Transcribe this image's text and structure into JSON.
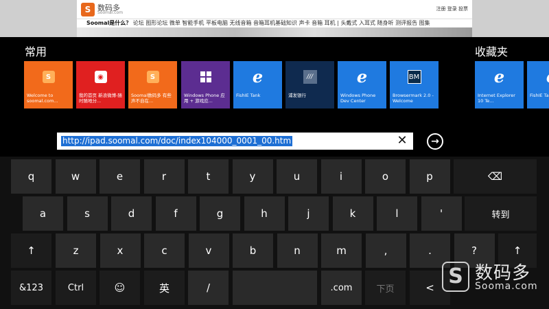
{
  "background_page": {
    "brand": "数码多",
    "brand_sub": "Soomal.com",
    "top_links": "注册 登录 投票",
    "nav_lead": "Soomal是什么？",
    "nav_items": "论坛 图形论坛 微单 智能手机 平板电脑 无线音箱 音箱耳机基础知识 声卡 音箱 耳机 | 头戴式 入耳式 随身听 测评报告 图集"
  },
  "sections": {
    "common": "常用",
    "favorites": "收藏夹"
  },
  "tiles": [
    {
      "label": "Welcome to soomal.com...",
      "icon": "S",
      "color": "#f26a1b"
    },
    {
      "label": "我的首页 新浪微博-随时随地分...",
      "icon": "weibo",
      "color": "#e02020"
    },
    {
      "label": "Soomal数码多 有些声不自在...",
      "icon": "S",
      "color": "#f26a1b"
    },
    {
      "label": "Windows Phone 应用 + 游戏应...",
      "icon": "windows",
      "color": "#5c2d91"
    },
    {
      "label": "FishIE Tank",
      "icon": "e",
      "color": "#1f7ae0"
    },
    {
      "label": "浦发银行",
      "icon": "bank",
      "color": "#0f2a4f"
    },
    {
      "label": "Windows Phone Dev Center",
      "icon": "e",
      "color": "#1f7ae0"
    },
    {
      "label": "Browsermark 2.0 - Welcome",
      "icon": "BM",
      "color": "#1f7ae0"
    },
    {
      "label": "Internet Explorer 10 Te...",
      "icon": "e",
      "color": "#1f7ae0"
    },
    {
      "label": "FishIE Tank",
      "icon": "e",
      "color": "#1f7ae0"
    }
  ],
  "address": {
    "url": "http://ipad.soomal.com/doc/index104000_0001_00.htm",
    "clear": "✕",
    "go": "→"
  },
  "keyboard": {
    "row1": [
      "q",
      "w",
      "e",
      "r",
      "t",
      "y",
      "u",
      "i",
      "o",
      "p"
    ],
    "backspace": "⌫",
    "row2": [
      "a",
      "s",
      "d",
      "f",
      "g",
      "h",
      "j",
      "k",
      "l",
      "'"
    ],
    "enter": "转到",
    "shift": "↑",
    "row3": [
      "z",
      "x",
      "c",
      "v",
      "b",
      "n",
      "m",
      ",",
      ".",
      "?"
    ],
    "num": "&123",
    "ctrl": "Ctrl",
    "emoji": "☺",
    "lang": "英",
    "slash": "/",
    "dotcom": ".com",
    "next_page": "下页",
    "left": "<"
  },
  "watermark": {
    "logo": "S",
    "cn": "数码多",
    "en": "Sooma.com"
  }
}
